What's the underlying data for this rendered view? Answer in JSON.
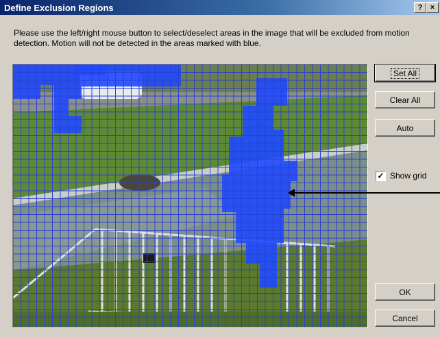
{
  "window": {
    "title": "Define Exclusion Regions",
    "help_glyph": "?",
    "close_glyph": "×"
  },
  "instructions": "Please use the left/right mouse button to select/deselect areas in the image that will be excluded from motion detection. Motion will not be detected in the areas marked with blue.",
  "buttons": {
    "set_all": "Set All",
    "clear_all": "Clear All",
    "auto": "Auto",
    "ok": "OK",
    "cancel": "Cancel"
  },
  "show_grid": {
    "label": "Show grid",
    "checked": true,
    "check_glyph": "✓"
  },
  "colors": {
    "exclusion_fill": "#1f49ff",
    "grid_line": "#2a40d8"
  }
}
